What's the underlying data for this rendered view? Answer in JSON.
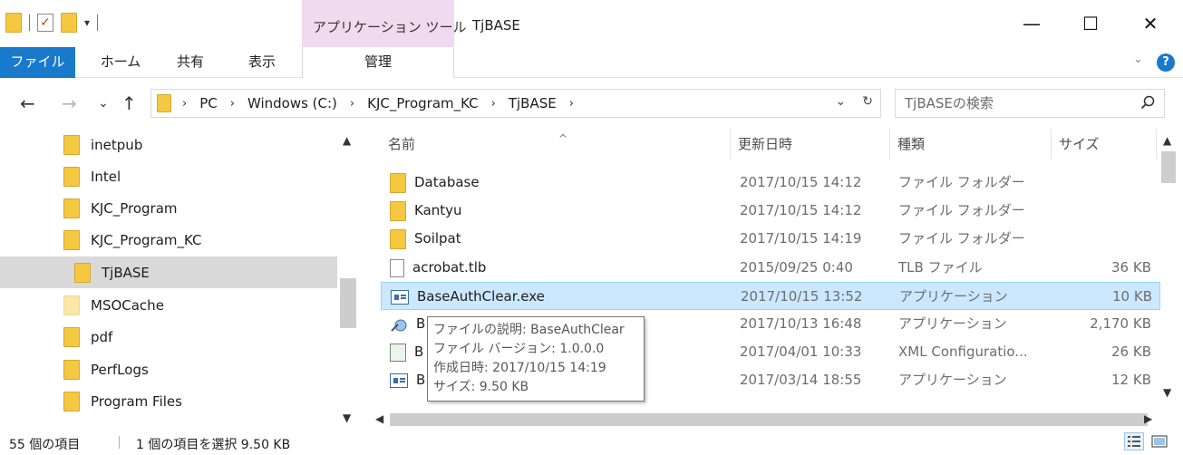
{
  "window": {
    "title": "TjBASE",
    "context_tab_group": "アプリケーション ツール",
    "minimize": "—",
    "maximize": "☐",
    "close": "✕"
  },
  "qat": {
    "dropdown": "▾"
  },
  "ribbon": {
    "tabs": [
      "ファイル",
      "ホーム",
      "共有",
      "表示",
      "管理"
    ],
    "expand": "⌄",
    "help": "?"
  },
  "nav": {
    "back": "←",
    "forward": "→",
    "recent": "⌄",
    "up": "↑"
  },
  "address": {
    "crumbs": [
      "PC",
      "Windows (C:)",
      "KJC_Program_KC",
      "TjBASE"
    ],
    "separator": "›",
    "dropdown": "⌄",
    "refresh": "↻"
  },
  "search": {
    "placeholder": "TjBASEの検索"
  },
  "tree": {
    "items": [
      "inetpub",
      "Intel",
      "KJC_Program",
      "KJC_Program_KC",
      "TjBASE",
      "MSOCache",
      "pdf",
      "PerfLogs",
      "Program Files"
    ]
  },
  "columns": {
    "name": "名前",
    "date": "更新日時",
    "type": "種類",
    "size": "サイズ"
  },
  "files": [
    {
      "name": "Database",
      "date": "2017/10/15 14:12",
      "type": "ファイル フォルダー",
      "size": "",
      "icon": "folder-icon"
    },
    {
      "name": "Kantyu",
      "date": "2017/10/15 14:12",
      "type": "ファイル フォルダー",
      "size": "",
      "icon": "folder-icon"
    },
    {
      "name": "Soilpat",
      "date": "2017/10/15 14:19",
      "type": "ファイル フォルダー",
      "size": "",
      "icon": "folder-icon"
    },
    {
      "name": "acrobat.tlb",
      "date": "2015/09/25 0:40",
      "type": "TLB ファイル",
      "size": "36 KB",
      "icon": "file-icon"
    },
    {
      "name": "BaseAuthClear.exe",
      "date": "2017/10/15 13:52",
      "type": "アプリケーション",
      "size": "10 KB",
      "icon": "exe-icon"
    },
    {
      "name": "B",
      "date": "2017/10/13 16:48",
      "type": "アプリケーション",
      "size": "2,170 KB",
      "icon": "wizard-icon"
    },
    {
      "name": "B",
      "date": "2017/04/01 10:33",
      "type": "XML Configuratio...",
      "size": "26 KB",
      "icon": "config-icon"
    },
    {
      "name": "B",
      "date": "2017/03/14 18:55",
      "type": "アプリケーション",
      "size": "12 KB",
      "icon": "exe-icon"
    }
  ],
  "tooltip": {
    "line1": "ファイルの説明: BaseAuthClear",
    "line2": "ファイル バージョン: 1.0.0.0",
    "line3": "作成日時: 2017/10/15 14:19",
    "line4": "サイズ: 9.50 KB"
  },
  "status": {
    "count": "55 個の項目",
    "selection": "1 個の項目を選択  9.50 KB"
  },
  "colors": {
    "file_tab": "#1979ca",
    "context_tab": "#efdaef",
    "selected_row": "#cce8ff",
    "folder": "#f5c842"
  }
}
